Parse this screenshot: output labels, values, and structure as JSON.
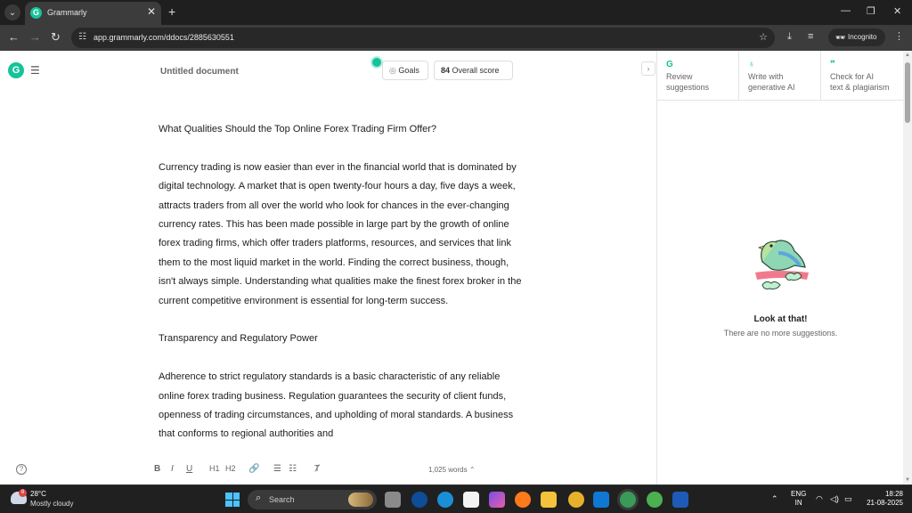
{
  "browser": {
    "tab_title": "Grammarly",
    "url": "app.grammarly.com/ddocs/2885630551",
    "incognito_label": "Incognito",
    "new_tab": "+",
    "tab_close": "✕"
  },
  "app": {
    "document_title": "Untitled document",
    "goals_label": "Goals",
    "overall_score": "84",
    "overall_score_label": "Overall score",
    "word_count": "1,025 words",
    "format_toolbar": {
      "bold": "B",
      "italic": "I",
      "underline": "U",
      "h1": "H1",
      "h2": "H2"
    }
  },
  "document": {
    "paragraphs": [
      "What Qualities Should the Top Online Forex Trading Firm Offer?",
      "Currency trading is now easier than ever in the financial world that is dominated by digital technology. A market that is open twenty-four hours a day, five days a week, attracts traders from all over the world who look for chances in the ever-changing currency rates. This has been made possible in large part by the growth of online forex trading firms, which offer traders platforms, resources, and services that link them to the most liquid market in the world. Finding the correct business, though, isn't always simple. Understanding what qualities make the finest forex broker in the current competitive environment is essential for long-term success.",
      "Transparency and Regulatory Power",
      "Adherence to strict regulatory standards is a basic characteristic of any reliable online forex trading business. Regulation guarantees the security of client funds, openness of trading circumstances, and upholding of moral standards. A business that conforms to regional authorities and"
    ]
  },
  "sidebar": {
    "tabs": [
      {
        "label_1": "Review",
        "label_2": "suggestions"
      },
      {
        "label_1": "Write with",
        "label_2": "generative AI"
      },
      {
        "label_1": "Check for AI",
        "label_2": "text & plagiarism"
      }
    ],
    "empty_title": "Look at that!",
    "empty_subtitle": "There are no more suggestions."
  },
  "taskbar": {
    "temperature": "28°C",
    "condition": "Mostly cloudy",
    "weather_badge": "8",
    "search_placeholder": "Search",
    "language_1": "ENG",
    "language_2": "IN",
    "time": "18:28",
    "date": "21-08-2025"
  },
  "colors": {
    "grammarly_green": "#15c39a",
    "chrome_dark": "#3c3c3c",
    "taskbar": "#202020"
  }
}
